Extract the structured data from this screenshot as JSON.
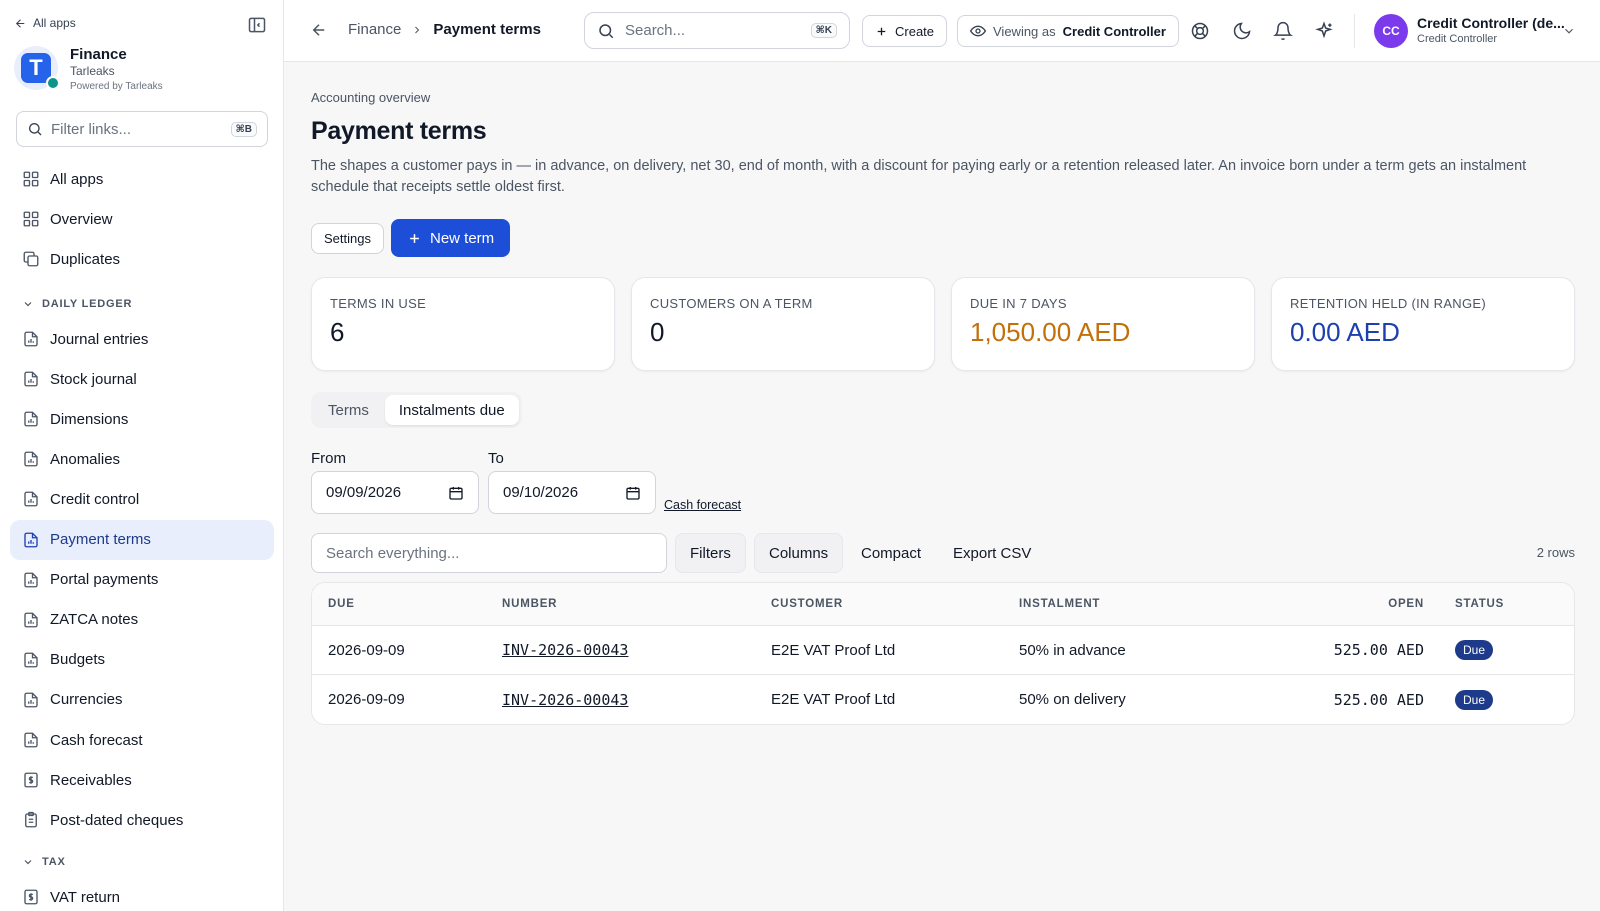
{
  "sidebar": {
    "back_label": "All apps",
    "brand": {
      "name": "Finance",
      "org": "Tarleaks",
      "powered": "Powered by Tarleaks",
      "logo_letter": "T"
    },
    "filter": {
      "placeholder": "Filter links...",
      "shortcut": "⌘B"
    },
    "top_items": [
      {
        "label": "All apps",
        "icon": "grid-icon"
      },
      {
        "label": "Overview",
        "icon": "grid-icon"
      },
      {
        "label": "Duplicates",
        "icon": "copy-icon"
      }
    ],
    "section_daily": "DAILY LEDGER",
    "ledger_items": [
      {
        "label": "Journal entries",
        "icon": "report-icon"
      },
      {
        "label": "Stock journal",
        "icon": "report-icon"
      },
      {
        "label": "Dimensions",
        "icon": "report-icon"
      },
      {
        "label": "Anomalies",
        "icon": "report-icon"
      },
      {
        "label": "Credit control",
        "icon": "report-icon"
      },
      {
        "label": "Payment terms",
        "icon": "report-icon",
        "active": true
      },
      {
        "label": "Portal payments",
        "icon": "report-icon"
      },
      {
        "label": "ZATCA notes",
        "icon": "report-icon"
      },
      {
        "label": "Budgets",
        "icon": "report-icon"
      },
      {
        "label": "Currencies",
        "icon": "report-icon"
      },
      {
        "label": "Cash forecast",
        "icon": "report-icon"
      },
      {
        "label": "Receivables",
        "icon": "dollar-icon"
      },
      {
        "label": "Post-dated cheques",
        "icon": "clipboard-icon"
      }
    ],
    "section_tax": "TAX",
    "tax_items": [
      {
        "label": "VAT return",
        "icon": "dollar-icon"
      }
    ]
  },
  "topbar": {
    "breadcrumb": [
      "Finance",
      "Payment terms"
    ],
    "search": {
      "placeholder": "Search...",
      "shortcut": "⌘K"
    },
    "create_label": "Create",
    "viewing_prefix": "Viewing as",
    "viewing_role": "Credit Controller",
    "user": {
      "initials": "CC",
      "name": "Credit Controller (de...",
      "role": "Credit Controller"
    }
  },
  "page": {
    "overline": "Accounting overview",
    "title": "Payment terms",
    "description": "The shapes a customer pays in — in advance, on delivery, net 30, end of month, with a discount for paying early or a retention released later. An invoice born under a term gets an instalment schedule that receipts settle oldest first.",
    "settings_label": "Settings",
    "new_term_label": "New term"
  },
  "kpis": [
    {
      "label": "TERMS IN USE",
      "value": "6",
      "color": "#111827"
    },
    {
      "label": "CUSTOMERS ON A TERM",
      "value": "0",
      "color": "#111827"
    },
    {
      "label": "DUE IN 7 DAYS",
      "value": "1,050.00 AED",
      "color": "#c2700a"
    },
    {
      "label": "RETENTION HELD (IN RANGE)",
      "value": "0.00 AED",
      "color": "#1e40af"
    }
  ],
  "tabs": [
    {
      "label": "Terms",
      "active": false
    },
    {
      "label": "Instalments due",
      "active": true
    }
  ],
  "range": {
    "from_label": "From",
    "from_value": "09/09/2026",
    "to_label": "To",
    "to_value": "09/10/2026",
    "link": "Cash forecast"
  },
  "toolbar": {
    "search_placeholder": "Search everything...",
    "filters": "Filters",
    "columns": "Columns",
    "compact": "Compact",
    "export": "Export CSV",
    "rows": "2 rows"
  },
  "table": {
    "headers": [
      "DUE",
      "NUMBER",
      "CUSTOMER",
      "INSTALMENT",
      "OPEN",
      "STATUS"
    ],
    "rows": [
      {
        "due": "2026-09-09",
        "number": "INV-2026-00043",
        "customer": "E2E VAT Proof Ltd",
        "instalment": "50% in advance",
        "open": "525.00 AED",
        "status": "Due"
      },
      {
        "due": "2026-09-09",
        "number": "INV-2026-00043",
        "customer": "E2E VAT Proof Ltd",
        "instalment": "50% on delivery",
        "open": "525.00 AED",
        "status": "Due"
      }
    ]
  }
}
